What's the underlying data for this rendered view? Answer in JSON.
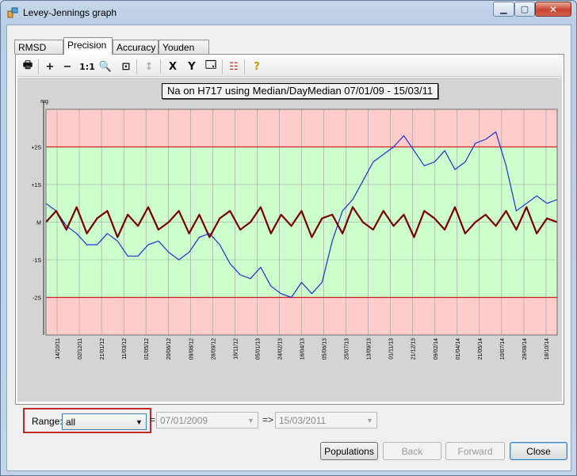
{
  "window": {
    "title": "Levey-Jennings graph",
    "buttons": {
      "minimize": "▁",
      "maximize": "▢",
      "close": "✕"
    }
  },
  "tabs": [
    {
      "label": "RMSD",
      "active": false
    },
    {
      "label": "Precision",
      "active": true
    },
    {
      "label": "Accuracy",
      "active": false
    },
    {
      "label": "Youden",
      "active": false
    }
  ],
  "toolbar": {
    "items": [
      {
        "icon": "printer-icon",
        "glyph": "🖶"
      },
      {
        "icon": "zoom-in-icon",
        "glyph": "+"
      },
      {
        "icon": "zoom-out-icon",
        "glyph": "−"
      },
      {
        "icon": "actual-size-icon",
        "glyph": "1:1"
      },
      {
        "icon": "magnifier-icon",
        "glyph": "🔍"
      },
      {
        "icon": "add-region-icon",
        "glyph": "⊡"
      },
      {
        "icon": "vertical-resize-icon",
        "glyph": "↕"
      },
      {
        "icon": "x-axis-icon",
        "glyph": "X"
      },
      {
        "icon": "y-axis-icon",
        "glyph": "Y"
      },
      {
        "icon": "properties-icon",
        "glyph": "🗔"
      },
      {
        "icon": "legend-icon",
        "glyph": "☷"
      },
      {
        "icon": "help-icon",
        "glyph": "?"
      }
    ]
  },
  "chart_data": {
    "type": "line",
    "title": "Na on H717 using Median/DayMedian  07/01/09 - 15/03/11",
    "ylabel": "mg",
    "y_ticks": [
      {
        "label": "+2S",
        "value": 2
      },
      {
        "label": "+1S",
        "value": 1
      },
      {
        "label": "M",
        "value": 0
      },
      {
        "label": "-1S",
        "value": -1
      },
      {
        "label": "-2S",
        "value": -2
      }
    ],
    "ylim": [
      -3,
      3
    ],
    "x_ticks": [
      "14/10/11",
      "02/12/11",
      "21/01/12",
      "11/03/12",
      "01/05/12",
      "20/06/12",
      "09/08/12",
      "28/09/12",
      "18/11/12",
      "05/01/13",
      "24/02/13",
      "16/04/13",
      "05/06/13",
      "25/07/13",
      "13/09/13",
      "01/11/13",
      "21/12/13",
      "09/02/14",
      "01/04/14",
      "21/05/14",
      "10/07/14",
      "29/08/14",
      "18/10/14"
    ],
    "bands": {
      "outer_color": "#ffcccc",
      "inner_color": "#ccffcc",
      "limit_line_color": "#cc2222"
    },
    "grid": true,
    "series": [
      {
        "color": "#1f2fd6",
        "values": [
          0.5,
          0.3,
          -0.1,
          -0.3,
          -0.6,
          -0.6,
          -0.3,
          -0.5,
          -0.9,
          -0.9,
          -0.6,
          -0.5,
          -0.8,
          -1.0,
          -0.8,
          -0.4,
          -0.3,
          -0.6,
          -1.1,
          -1.4,
          -1.5,
          -1.2,
          -1.7,
          -1.9,
          -2.0,
          -1.6,
          -1.9,
          -1.6,
          -0.5,
          0.3,
          0.6,
          1.1,
          1.6,
          1.8,
          2.0,
          2.3,
          1.9,
          1.5,
          1.6,
          1.9,
          1.4,
          1.6,
          2.1,
          2.2,
          2.4,
          1.5,
          0.3,
          0.5,
          0.7,
          0.5,
          0.6
        ]
      },
      {
        "color": "#7a0000",
        "values": [
          0.0,
          0.3,
          -0.2,
          0.4,
          -0.3,
          0.1,
          0.3,
          -0.4,
          0.2,
          -0.1,
          0.4,
          -0.2,
          0.0,
          0.3,
          -0.3,
          0.2,
          -0.4,
          0.1,
          0.3,
          -0.2,
          0.0,
          0.4,
          -0.3,
          0.2,
          -0.1,
          0.3,
          -0.4,
          0.1,
          0.2,
          -0.3,
          0.4,
          0.0,
          -0.2,
          0.3,
          -0.1,
          0.2,
          -0.4,
          0.3,
          0.1,
          -0.2,
          0.4,
          -0.3,
          0.0,
          0.2,
          -0.1,
          0.3,
          -0.2,
          0.4,
          -0.3,
          0.1,
          0.0
        ]
      }
    ]
  },
  "range": {
    "label": "Range:",
    "selected": "all",
    "eq": "=",
    "start_date": "07/01/2009",
    "arrow": "=>",
    "end_date": "15/03/2011"
  },
  "buttons": {
    "populations": "Populations",
    "back": "Back",
    "forward": "Forward",
    "close": "Close"
  }
}
